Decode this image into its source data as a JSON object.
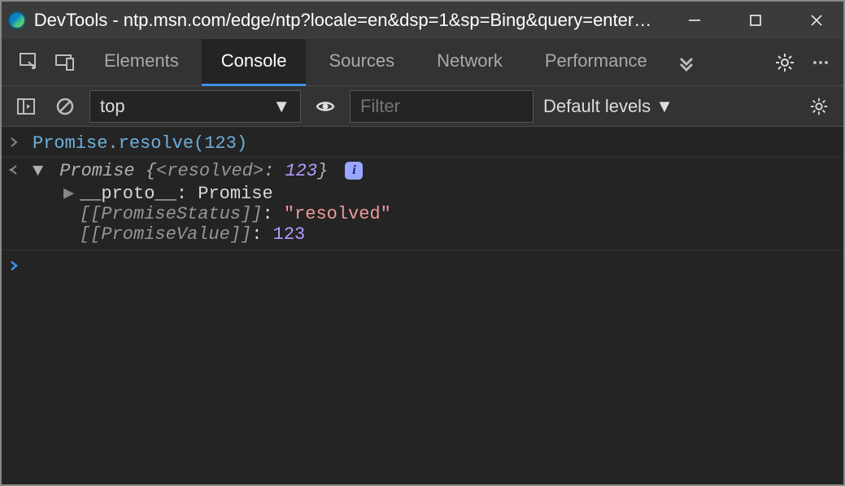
{
  "titlebar": {
    "title": "DevTools - ntp.msn.com/edge/ntp?locale=en&dsp=1&sp=Bing&query=enterpri..."
  },
  "tabs": {
    "elements": "Elements",
    "console": "Console",
    "sources": "Sources",
    "network": "Network",
    "performance": "Performance"
  },
  "console_toolbar": {
    "context": "top",
    "filter_placeholder": "Filter",
    "filter_value": "",
    "levels": "Default levels"
  },
  "console_output": {
    "input_line": "Promise.resolve(123)",
    "result": {
      "class_name": "Promise",
      "brace_open": "{",
      "resolved_key": "<resolved>",
      "resolved_sep": ": ",
      "resolved_val": "123",
      "brace_close": "}",
      "proto_label": "__proto__",
      "proto_value": "Promise",
      "status_key": "[[PromiseStatus]]",
      "status_value": "\"resolved\"",
      "value_key": "[[PromiseValue]]",
      "value_value": "123"
    }
  }
}
